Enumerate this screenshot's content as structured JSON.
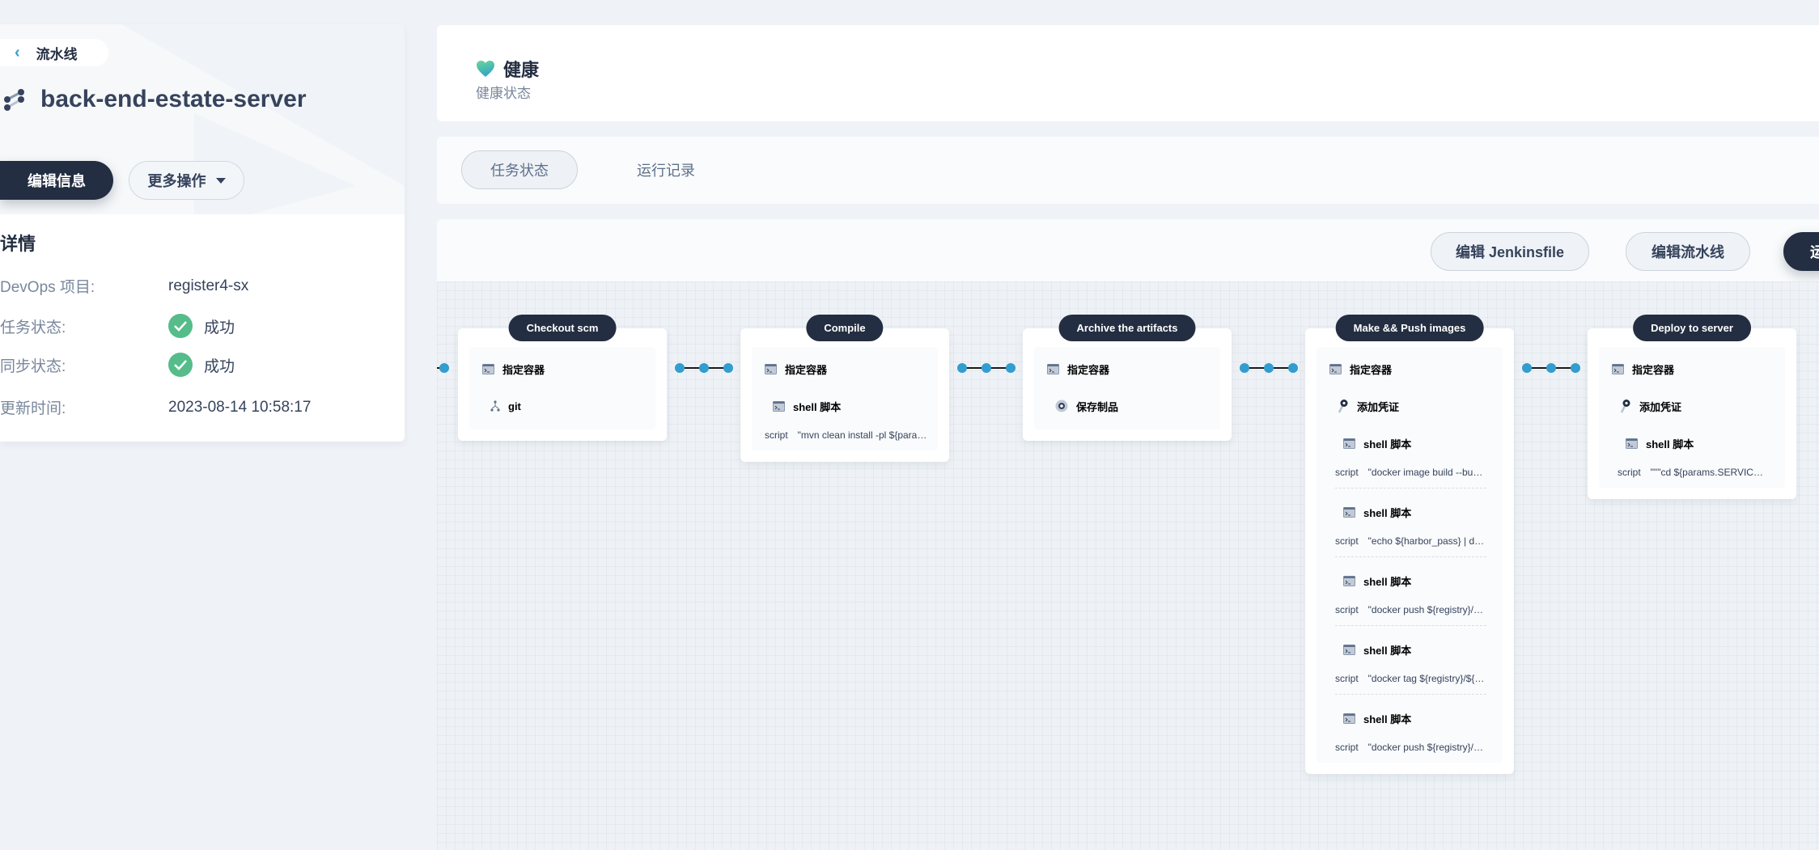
{
  "colors": {
    "accent": "#329dce",
    "dark": "#242e42",
    "success": "#55bc8a"
  },
  "sidebar": {
    "back_label": "流水线",
    "back_icon": "chevron-left-icon",
    "pipeline_icon": "pipeline-icon",
    "title": "back-end-estate-server",
    "edit_button": "编辑信息",
    "more_button": "更多操作",
    "details_title": "详情",
    "details": [
      {
        "label": "DevOps 项目:",
        "value": "register4-sx"
      },
      {
        "label": "任务状态:",
        "value": "成功",
        "status": "success"
      },
      {
        "label": "同步状态:",
        "value": "成功",
        "status": "success"
      },
      {
        "label": "更新时间:",
        "value": "2023-08-14 10:58:17"
      }
    ]
  },
  "health": {
    "icon": "heart-icon",
    "title": "健康",
    "subtitle": "健康状态"
  },
  "tabs": [
    {
      "label": "任务状态",
      "active": true
    },
    {
      "label": "运行记录",
      "active": false
    }
  ],
  "toolbar": {
    "edit_jenkinsfile": "编辑 Jenkinsfile",
    "edit_pipeline": "编辑流水线",
    "run": "运行"
  },
  "stages": [
    {
      "name": "Checkout scm",
      "container": "指定容器",
      "items": [
        {
          "icon": "git-branch-icon",
          "label": "git"
        }
      ]
    },
    {
      "name": "Compile",
      "container": "指定容器",
      "items": [
        {
          "icon": "terminal-icon",
          "label": "shell 脚本",
          "script_key": "script",
          "script": "\"mvn clean install -pl ${para…"
        }
      ]
    },
    {
      "name": "Archive the artifacts",
      "container": "指定容器",
      "items": [
        {
          "icon": "archive-icon",
          "label": "保存制品"
        }
      ]
    },
    {
      "name": "Make && Push images",
      "container": "指定容器",
      "credential": {
        "icon": "key-icon",
        "label": "添加凭证"
      },
      "items": [
        {
          "icon": "terminal-icon",
          "label": "shell 脚本",
          "script_key": "script",
          "script": "\"docker image build --bu…"
        },
        {
          "icon": "terminal-icon",
          "label": "shell 脚本",
          "script_key": "script",
          "script": "\"echo ${harbor_pass} | d…"
        },
        {
          "icon": "terminal-icon",
          "label": "shell 脚本",
          "script_key": "script",
          "script": "\"docker push ${registry}/…"
        },
        {
          "icon": "terminal-icon",
          "label": "shell 脚本",
          "script_key": "script",
          "script": "\"docker tag ${registry}/${…"
        },
        {
          "icon": "terminal-icon",
          "label": "shell 脚本",
          "script_key": "script",
          "script": "\"docker push ${registry}/…"
        }
      ]
    },
    {
      "name": "Deploy to server",
      "container": "指定容器",
      "credential": {
        "icon": "key-icon",
        "label": "添加凭证"
      },
      "items": [
        {
          "icon": "terminal-icon",
          "label": "shell 脚本",
          "script_key": "script",
          "script": "\"\"\"cd ${params.SERVIC…"
        }
      ]
    }
  ]
}
